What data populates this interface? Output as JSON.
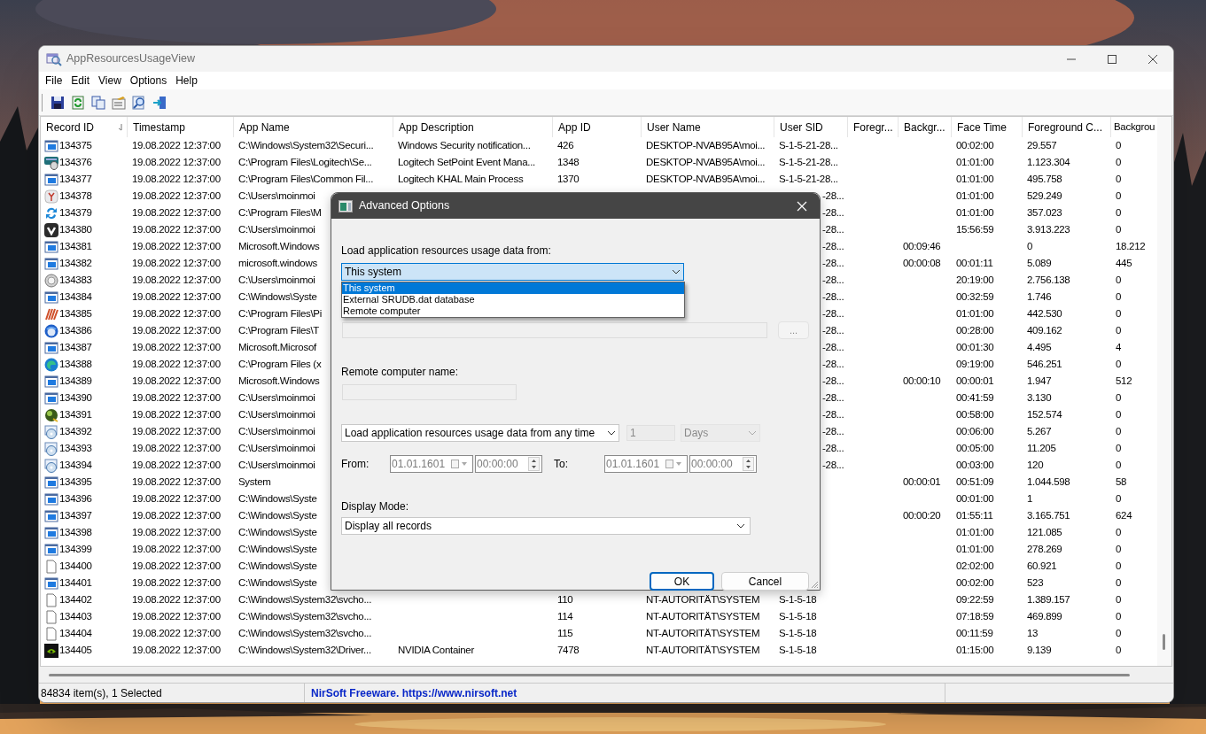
{
  "window": {
    "title": "AppResourcesUsageView"
  },
  "menu": [
    "File",
    "Edit",
    "View",
    "Options",
    "Help"
  ],
  "table": {
    "columns": [
      {
        "label": "Record ID",
        "sorted": true
      },
      {
        "label": "Timestamp",
        "sorted": false
      },
      {
        "label": "App Name",
        "sorted": false
      },
      {
        "label": "App Description",
        "sorted": false
      },
      {
        "label": "App ID",
        "sorted": false
      },
      {
        "label": "User Name",
        "sorted": false
      },
      {
        "label": "User SID",
        "sorted": false
      },
      {
        "label": "Foregr...",
        "sorted": false
      },
      {
        "label": "Backgr...",
        "sorted": false
      },
      {
        "label": "Face Time",
        "sorted": false
      },
      {
        "label": "Foreground C...",
        "sorted": false
      },
      {
        "label": "Backgrou",
        "sorted": false
      }
    ],
    "rows": [
      {
        "kind": "window",
        "cells": [
          "134375",
          "19.08.2022 12:37:00",
          "C:\\Windows\\System32\\Securi...",
          "Windows Security notification...",
          "426",
          "DESKTOP-NVAB95A\\moi...",
          "S-1-5-21-28...",
          null,
          null,
          "00:02:00",
          "29.557",
          "0"
        ]
      },
      {
        "kind": "mouse",
        "cells": [
          "134376",
          "19.08.2022 12:37:00",
          "C:\\Program Files\\Logitech\\Se...",
          "Logitech SetPoint Event Mana...",
          "1348",
          "DESKTOP-NVAB95A\\moi...",
          "S-1-5-21-28...",
          null,
          null,
          "01:01:00",
          "1.123.304",
          "0"
        ]
      },
      {
        "kind": "window",
        "cells": [
          "134377",
          "19.08.2022 12:37:00",
          "C:\\Program Files\\Common Fil...",
          "Logitech KHAL Main Process",
          "1370",
          "DESKTOP-NVAB95A\\moi...",
          "S-1-5-21-28...",
          null,
          null,
          "01:01:00",
          "495.758",
          "0"
        ]
      },
      {
        "kind": "fork",
        "cells": [
          "134378",
          "19.08.2022 12:37:00",
          "C:\\Users\\moinmoi",
          null,
          null,
          null,
          "-28...",
          null,
          null,
          "01:01:00",
          "529.249",
          "0"
        ]
      },
      {
        "kind": "arrows",
        "cells": [
          "134379",
          "19.08.2022 12:37:00",
          "C:\\Program Files\\M",
          null,
          null,
          null,
          "-28...",
          null,
          null,
          "01:01:00",
          "357.023",
          "0"
        ]
      },
      {
        "kind": "chevron",
        "cells": [
          "134380",
          "19.08.2022 12:37:00",
          "C:\\Users\\moinmoi",
          null,
          null,
          null,
          "-28...",
          null,
          null,
          "15:56:59",
          "3.913.223",
          "0"
        ]
      },
      {
        "kind": "window",
        "cells": [
          "134381",
          "19.08.2022 12:37:00",
          "Microsoft.Windows",
          null,
          null,
          null,
          "-28...",
          null,
          "00:09:46",
          null,
          "0",
          "18.212"
        ]
      },
      {
        "kind": "window",
        "cells": [
          "134382",
          "19.08.2022 12:37:00",
          "microsoft.windows",
          null,
          null,
          null,
          "-28...",
          null,
          "00:00:08",
          "00:01:11",
          "5.089",
          "445"
        ]
      },
      {
        "kind": "disc",
        "cells": [
          "134383",
          "19.08.2022 12:37:00",
          "C:\\Users\\moinmoi",
          null,
          null,
          null,
          "-28...",
          null,
          null,
          "20:19:00",
          "2.756.138",
          "0"
        ]
      },
      {
        "kind": "window",
        "cells": [
          "134384",
          "19.08.2022 12:37:00",
          "C:\\Windows\\Syste",
          null,
          null,
          null,
          "-28...",
          null,
          null,
          "00:32:59",
          "1.746",
          "0"
        ]
      },
      {
        "kind": "stripes",
        "cells": [
          "134385",
          "19.08.2022 12:37:00",
          "C:\\Program Files\\Pi",
          null,
          null,
          null,
          "-28...",
          null,
          null,
          "01:01:00",
          "442.530",
          "0"
        ]
      },
      {
        "kind": "globe",
        "cells": [
          "134386",
          "19.08.2022 12:37:00",
          "C:\\Program Files\\T",
          null,
          null,
          null,
          "-28...",
          null,
          null,
          "00:28:00",
          "409.162",
          "0"
        ]
      },
      {
        "kind": "window",
        "cells": [
          "134387",
          "19.08.2022 12:37:00",
          "Microsoft.Microsof",
          null,
          null,
          null,
          "-28...",
          null,
          null,
          "00:01:30",
          "4.495",
          "4"
        ]
      },
      {
        "kind": "swirl",
        "cells": [
          "134388",
          "19.08.2022 12:37:00",
          "C:\\Program Files (x",
          null,
          null,
          null,
          "-28...",
          null,
          null,
          "09:19:00",
          "546.251",
          "0"
        ]
      },
      {
        "kind": "window",
        "cells": [
          "134389",
          "19.08.2022 12:37:00",
          "Microsoft.Windows",
          null,
          null,
          null,
          "-28...",
          null,
          "00:00:10",
          "00:00:01",
          "1.947",
          "512"
        ]
      },
      {
        "kind": "window",
        "cells": [
          "134390",
          "19.08.2022 12:37:00",
          "C:\\Users\\moinmoi",
          null,
          null,
          null,
          "-28...",
          null,
          null,
          "00:41:59",
          "3.130",
          "0"
        ]
      },
      {
        "kind": "ball",
        "cells": [
          "134391",
          "19.08.2022 12:37:00",
          "C:\\Users\\moinmoi",
          null,
          null,
          null,
          "-28...",
          null,
          null,
          "00:58:00",
          "152.574",
          "0"
        ]
      },
      {
        "kind": "cd",
        "cells": [
          "134392",
          "19.08.2022 12:37:00",
          "C:\\Users\\moinmoi",
          null,
          null,
          null,
          "-28...",
          null,
          null,
          "00:06:00",
          "5.267",
          "0"
        ]
      },
      {
        "kind": "cd",
        "cells": [
          "134393",
          "19.08.2022 12:37:00",
          "C:\\Users\\moinmoi",
          null,
          null,
          null,
          "-28...",
          null,
          null,
          "00:05:00",
          "11.205",
          "0"
        ]
      },
      {
        "kind": "cd",
        "cells": [
          "134394",
          "19.08.2022 12:37:00",
          "C:\\Users\\moinmoi",
          null,
          null,
          null,
          "-28...",
          null,
          null,
          "00:03:00",
          "120",
          "0"
        ]
      },
      {
        "kind": "window",
        "cells": [
          "134395",
          "19.08.2022 12:37:00",
          "System",
          null,
          null,
          null,
          null,
          null,
          "00:00:01",
          "00:51:09",
          "1.044.598",
          "58"
        ]
      },
      {
        "kind": "window",
        "cells": [
          "134396",
          "19.08.2022 12:37:00",
          "C:\\Windows\\Syste",
          null,
          null,
          null,
          null,
          null,
          null,
          "00:01:00",
          "1",
          "0"
        ]
      },
      {
        "kind": "window",
        "cells": [
          "134397",
          "19.08.2022 12:37:00",
          "C:\\Windows\\Syste",
          null,
          null,
          null,
          null,
          null,
          "00:00:20",
          "01:55:11",
          "3.165.751",
          "624"
        ]
      },
      {
        "kind": "window",
        "cells": [
          "134398",
          "19.08.2022 12:37:00",
          "C:\\Windows\\Syste",
          null,
          null,
          null,
          null,
          null,
          null,
          "01:01:00",
          "121.085",
          "0"
        ]
      },
      {
        "kind": "window",
        "cells": [
          "134399",
          "19.08.2022 12:37:00",
          "C:\\Windows\\Syste",
          null,
          null,
          null,
          null,
          null,
          null,
          "01:01:00",
          "278.269",
          "0"
        ]
      },
      {
        "kind": "file",
        "cells": [
          "134400",
          "19.08.2022 12:37:00",
          "C:\\Windows\\Syste",
          null,
          null,
          null,
          null,
          null,
          null,
          "02:02:00",
          "60.921",
          "0"
        ]
      },
      {
        "kind": "window",
        "cells": [
          "134401",
          "19.08.2022 12:37:00",
          "C:\\Windows\\Syste",
          null,
          null,
          null,
          null,
          null,
          null,
          "00:02:00",
          "523",
          "0"
        ]
      },
      {
        "kind": "file",
        "cells": [
          "134402",
          "19.08.2022 12:37:00",
          "C:\\Windows\\System32\\svcho...",
          null,
          "110",
          "NT-AUTORITÄT\\SYSTEM",
          "S-1-5-18",
          null,
          null,
          "09:22:59",
          "1.389.157",
          "0"
        ]
      },
      {
        "kind": "file",
        "cells": [
          "134403",
          "19.08.2022 12:37:00",
          "C:\\Windows\\System32\\svcho...",
          null,
          "114",
          "NT-AUTORITÄT\\SYSTEM",
          "S-1-5-18",
          null,
          null,
          "07:18:59",
          "469.899",
          "0"
        ]
      },
      {
        "kind": "file",
        "cells": [
          "134404",
          "19.08.2022 12:37:00",
          "C:\\Windows\\System32\\svcho...",
          null,
          "115",
          "NT-AUTORITÄT\\SYSTEM",
          "S-1-5-18",
          null,
          null,
          "00:11:59",
          "13",
          "0"
        ]
      },
      {
        "kind": "chip",
        "cells": [
          "134405",
          "19.08.2022 12:37:00",
          "C:\\Windows\\System32\\Driver...",
          "NVIDIA Container",
          "7478",
          "NT-AUTORITÄT\\SYSTEM",
          "S-1-5-18",
          null,
          null,
          "01:15:00",
          "9.139",
          "0"
        ]
      }
    ]
  },
  "dialog": {
    "title": "Advanced Options",
    "source_label": "Load application resources usage data from:",
    "source_select": {
      "value": "This system",
      "focused": true,
      "options": [
        {
          "label": "This system",
          "selected": true
        },
        {
          "label": "External SRUDB.dat database",
          "selected": false
        },
        {
          "label": "Remote computer",
          "selected": false
        }
      ]
    },
    "database_path": {
      "disabled": true
    },
    "browse_button": {
      "label": "...",
      "disabled": true
    },
    "remote_label": "Remote computer name:",
    "remote_field": {
      "disabled": true
    },
    "time_range": {
      "value": "Load application resources usage data from any time"
    },
    "count_field": {
      "value": "1",
      "disabled": true
    },
    "unit_select": {
      "value": "Days",
      "disabled": true
    },
    "from": {
      "label": "From:",
      "date": "01.01.1601",
      "time": "00:00:00",
      "disabled": true
    },
    "to": {
      "label": "To:",
      "date": "01.01.1601",
      "time": "00:00:00",
      "disabled": true
    },
    "display_mode_label": "Display Mode:",
    "display_mode": {
      "value": "Display all records"
    },
    "buttons": [
      {
        "label": "OK",
        "default": true
      },
      {
        "label": "Cancel",
        "default": false
      }
    ]
  },
  "status_bar": [
    "84834 item(s), 1 Selected",
    "NirSoft Freeware. https://www.nirsoft.net"
  ]
}
